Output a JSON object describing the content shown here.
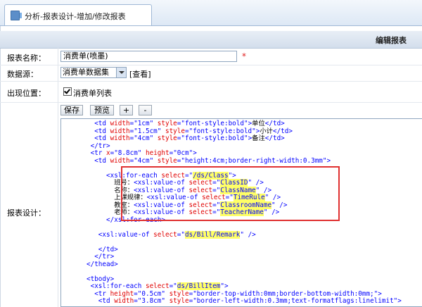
{
  "tab": {
    "label": "分析-报表设计-增加/修改报表"
  },
  "header": {
    "title": "编辑报表"
  },
  "form": {
    "name_label": "报表名称：",
    "name_value": "消费单(喷墨)",
    "required_mark": "*",
    "datasource_label": "数据源：",
    "datasource_value": "消费单数据集",
    "view_link": "[查看]",
    "position_label": "出现位置：",
    "position_checkbox_label": "消费单列表",
    "position_checked": true,
    "design_label": "报表设计："
  },
  "toolbar": {
    "save": "保存",
    "preview": "预览",
    "plus": "+",
    "minus": "-"
  },
  "editor": {
    "lines": [
      "<td width=\"1cm\" style=\"font-style:bold\">单位</td>",
      "<td width=\"1.5cm\" style=\"font-style:bold\">小计</td>",
      "<td width=\"4cm\" style=\"font-style:bold\">备注</td>",
      "</tr>",
      "<tr x=\"8.8cm\" height=\"0cm\">",
      "<td width=\"4cm\" style=\"height:4cm;border-right-width:0.3mm\">",
      "",
      "<xsl:for-each select=\"/ds/Class\">",
      "班号：<xsl:value-of select=\"ClassID\" />",
      "名称：<xsl:value-of select=\"ClassName\" />",
      "上课规律：<xsl:value-of select=\"TimeRule\" />",
      "教室：<xsl:value-of select=\"ClassroomName\" />",
      "老师：<xsl:value-of select=\"TeacherName\" />",
      "</xsl:for-each>",
      "",
      "<xsl:value-of select=\"ds/Bill/Remark\" />",
      "",
      "</td>",
      "</tr>",
      "</thead>",
      "",
      "<tbody>",
      "<xsl:for-each select=\"ds/BillItem\">",
      "<tr height=\"0.5cm\" style=\"border-top-width:0mm;border-bottom-width:0mm;\">",
      "<td width=\"3.8cm\" style=\"border-left-width:0.3mm;text-formatflags:linelimit\">"
    ]
  }
}
